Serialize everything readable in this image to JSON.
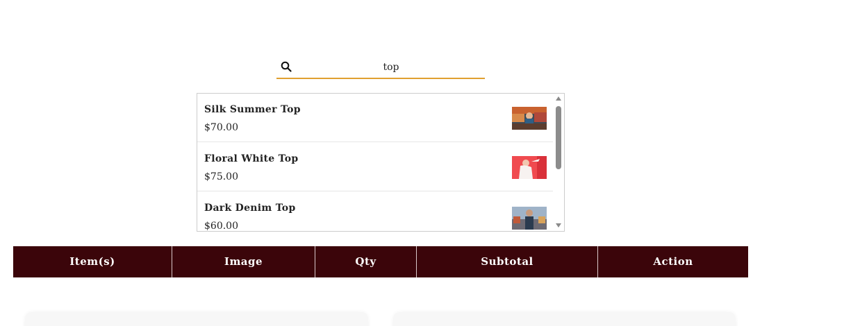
{
  "search": {
    "value": "top",
    "icon": "search-icon",
    "accent_color": "#e0a030"
  },
  "results": [
    {
      "name": "Silk Summer Top",
      "price": "$70.00"
    },
    {
      "name": "Floral White Top",
      "price": "$75.00"
    },
    {
      "name": "Dark Denim Top",
      "price": "$60.00"
    }
  ],
  "table": {
    "header_bg": "#3b050a",
    "columns": [
      "Item(s)",
      "Image",
      "Qty",
      "Subtotal",
      "Action"
    ]
  }
}
